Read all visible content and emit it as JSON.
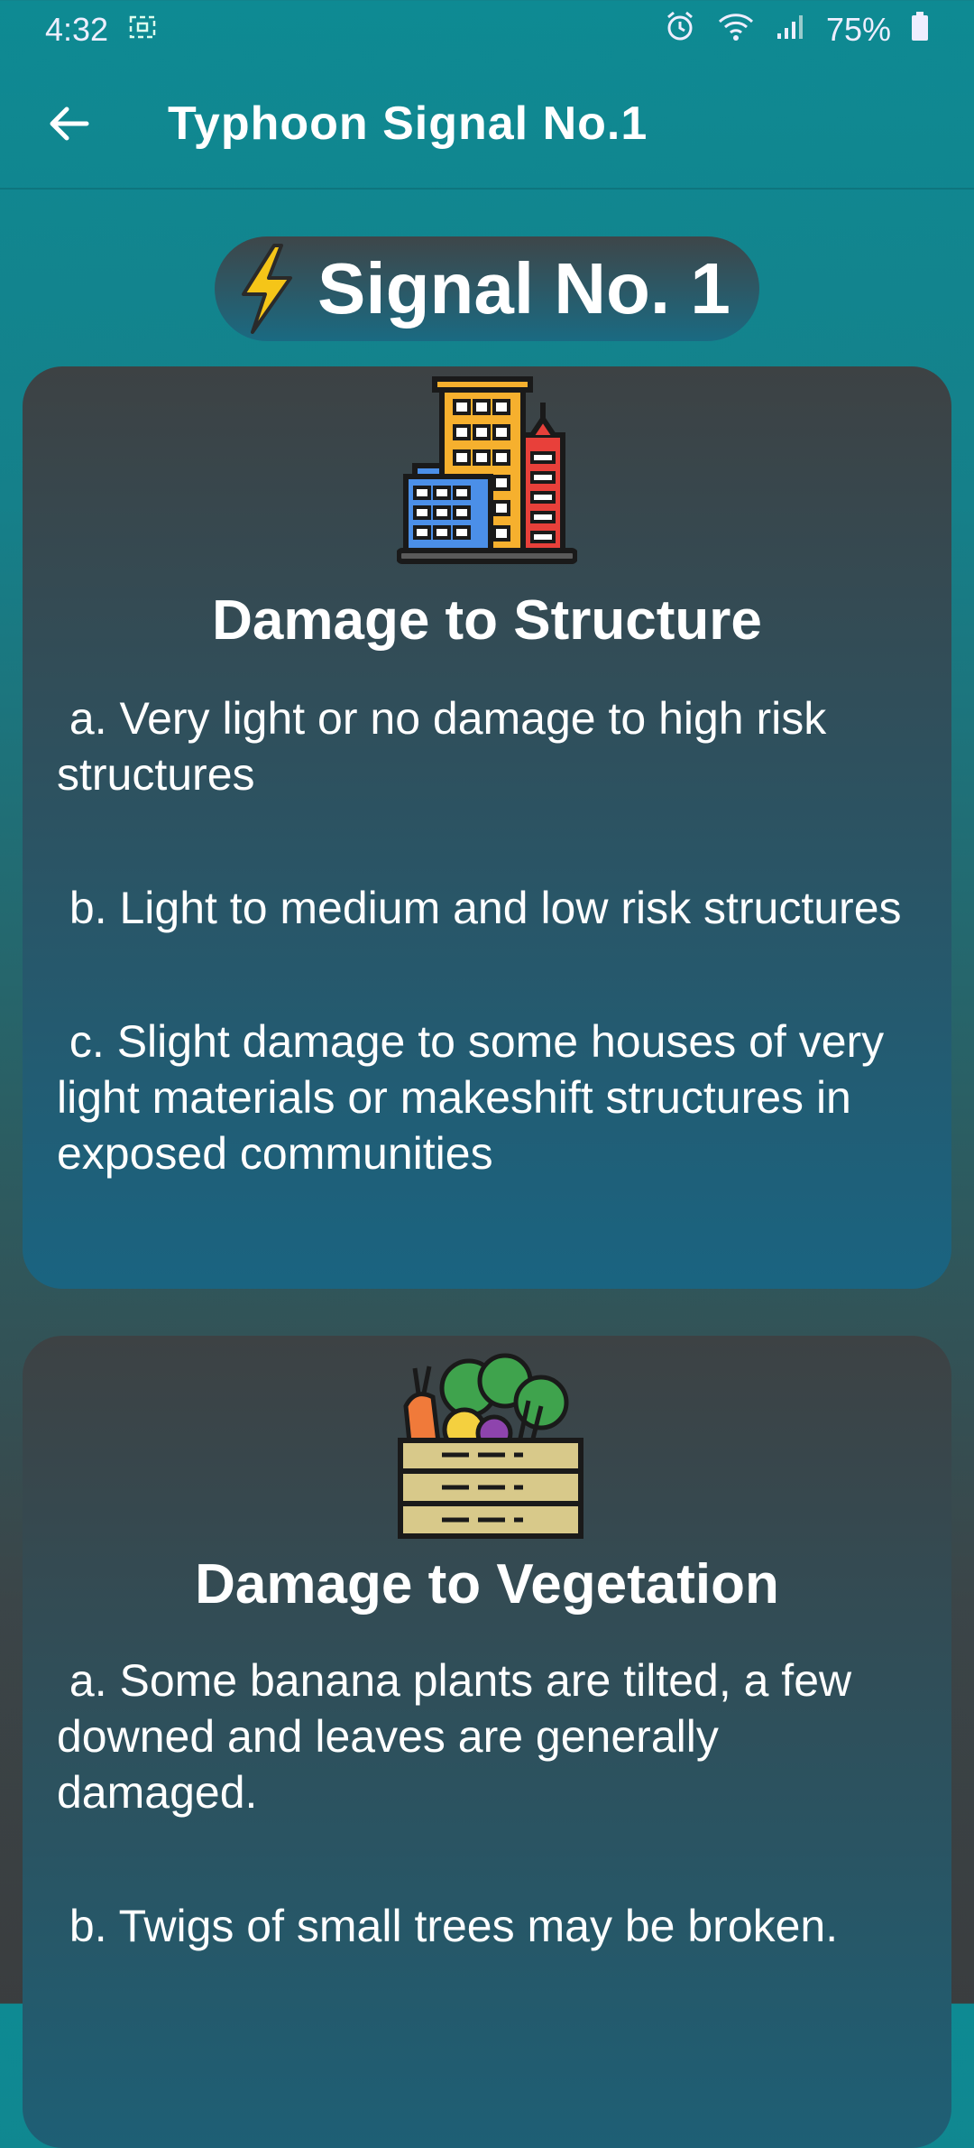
{
  "status_bar": {
    "time": "4:32",
    "battery": "75%"
  },
  "app_bar": {
    "title": "Typhoon Signal No.1"
  },
  "signal": {
    "label": "Signal No. 1"
  },
  "structure_card": {
    "heading": "Damage to Structure",
    "items": [
      " a. Very light or no damage to high risk structures",
      " b. Light to medium and low risk structures",
      " c. Slight damage to some houses of very light materials or makeshift structures in exposed communities"
    ]
  },
  "vegetation_card": {
    "heading": "Damage to Vegetation",
    "items": [
      " a. Some banana plants are tilted, a few downed and leaves are generally damaged.",
      " b. Twigs of small trees may be broken."
    ]
  },
  "colors": {
    "accent": "#0e8a93",
    "card_top": "#3d4244",
    "card_bottom": "#1a6481",
    "bolt": "#f5c518"
  }
}
